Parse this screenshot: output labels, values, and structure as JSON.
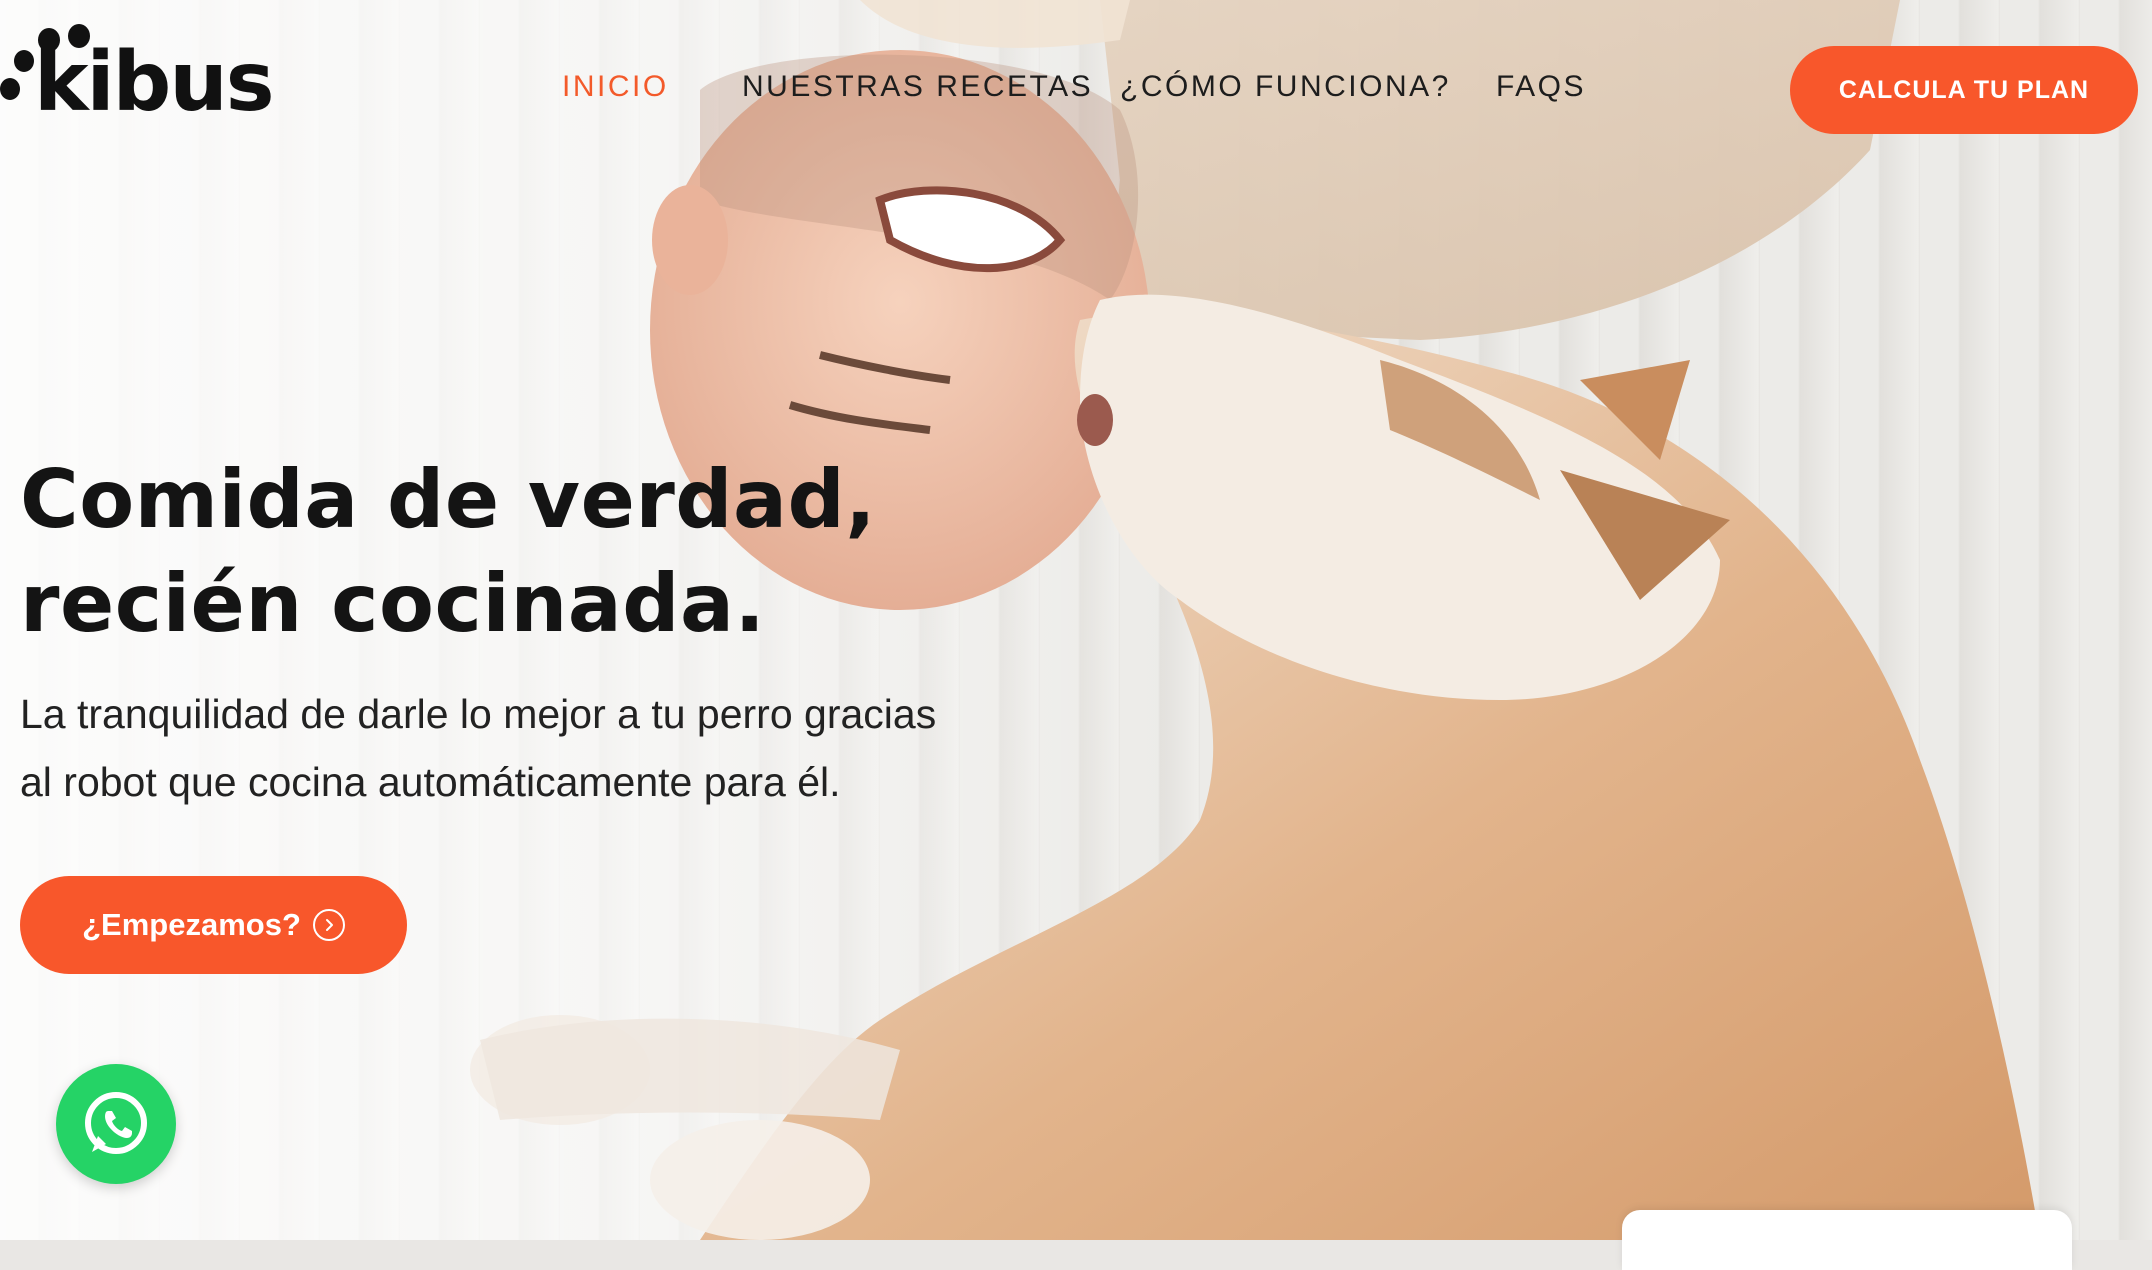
{
  "brand": {
    "name": "kibus",
    "accent_color": "#f8572b",
    "whatsapp_color": "#25d366"
  },
  "nav": {
    "items": [
      {
        "label": "INICIO",
        "active": true
      },
      {
        "label": "NUESTRAS RECETAS",
        "active": false
      },
      {
        "label": "¿CÓMO FUNCIONA?",
        "active": false
      },
      {
        "label": "FAQS",
        "active": false
      }
    ],
    "cta_label": "CALCULA TU PLAN"
  },
  "hero": {
    "title_line1": "Comida de verdad,",
    "title_line2": "recién cocinada.",
    "subtitle_line1": "La tranquilidad de darle lo mejor a tu perro gracias",
    "subtitle_line2": "al robot que cocina automáticamente para él.",
    "cta_label": "¿Empezamos?",
    "cta_icon": "chevron-right-circle-icon",
    "background": "hero-photo-man-and-husky-dog"
  },
  "floating": {
    "whatsapp_icon": "whatsapp-icon"
  }
}
